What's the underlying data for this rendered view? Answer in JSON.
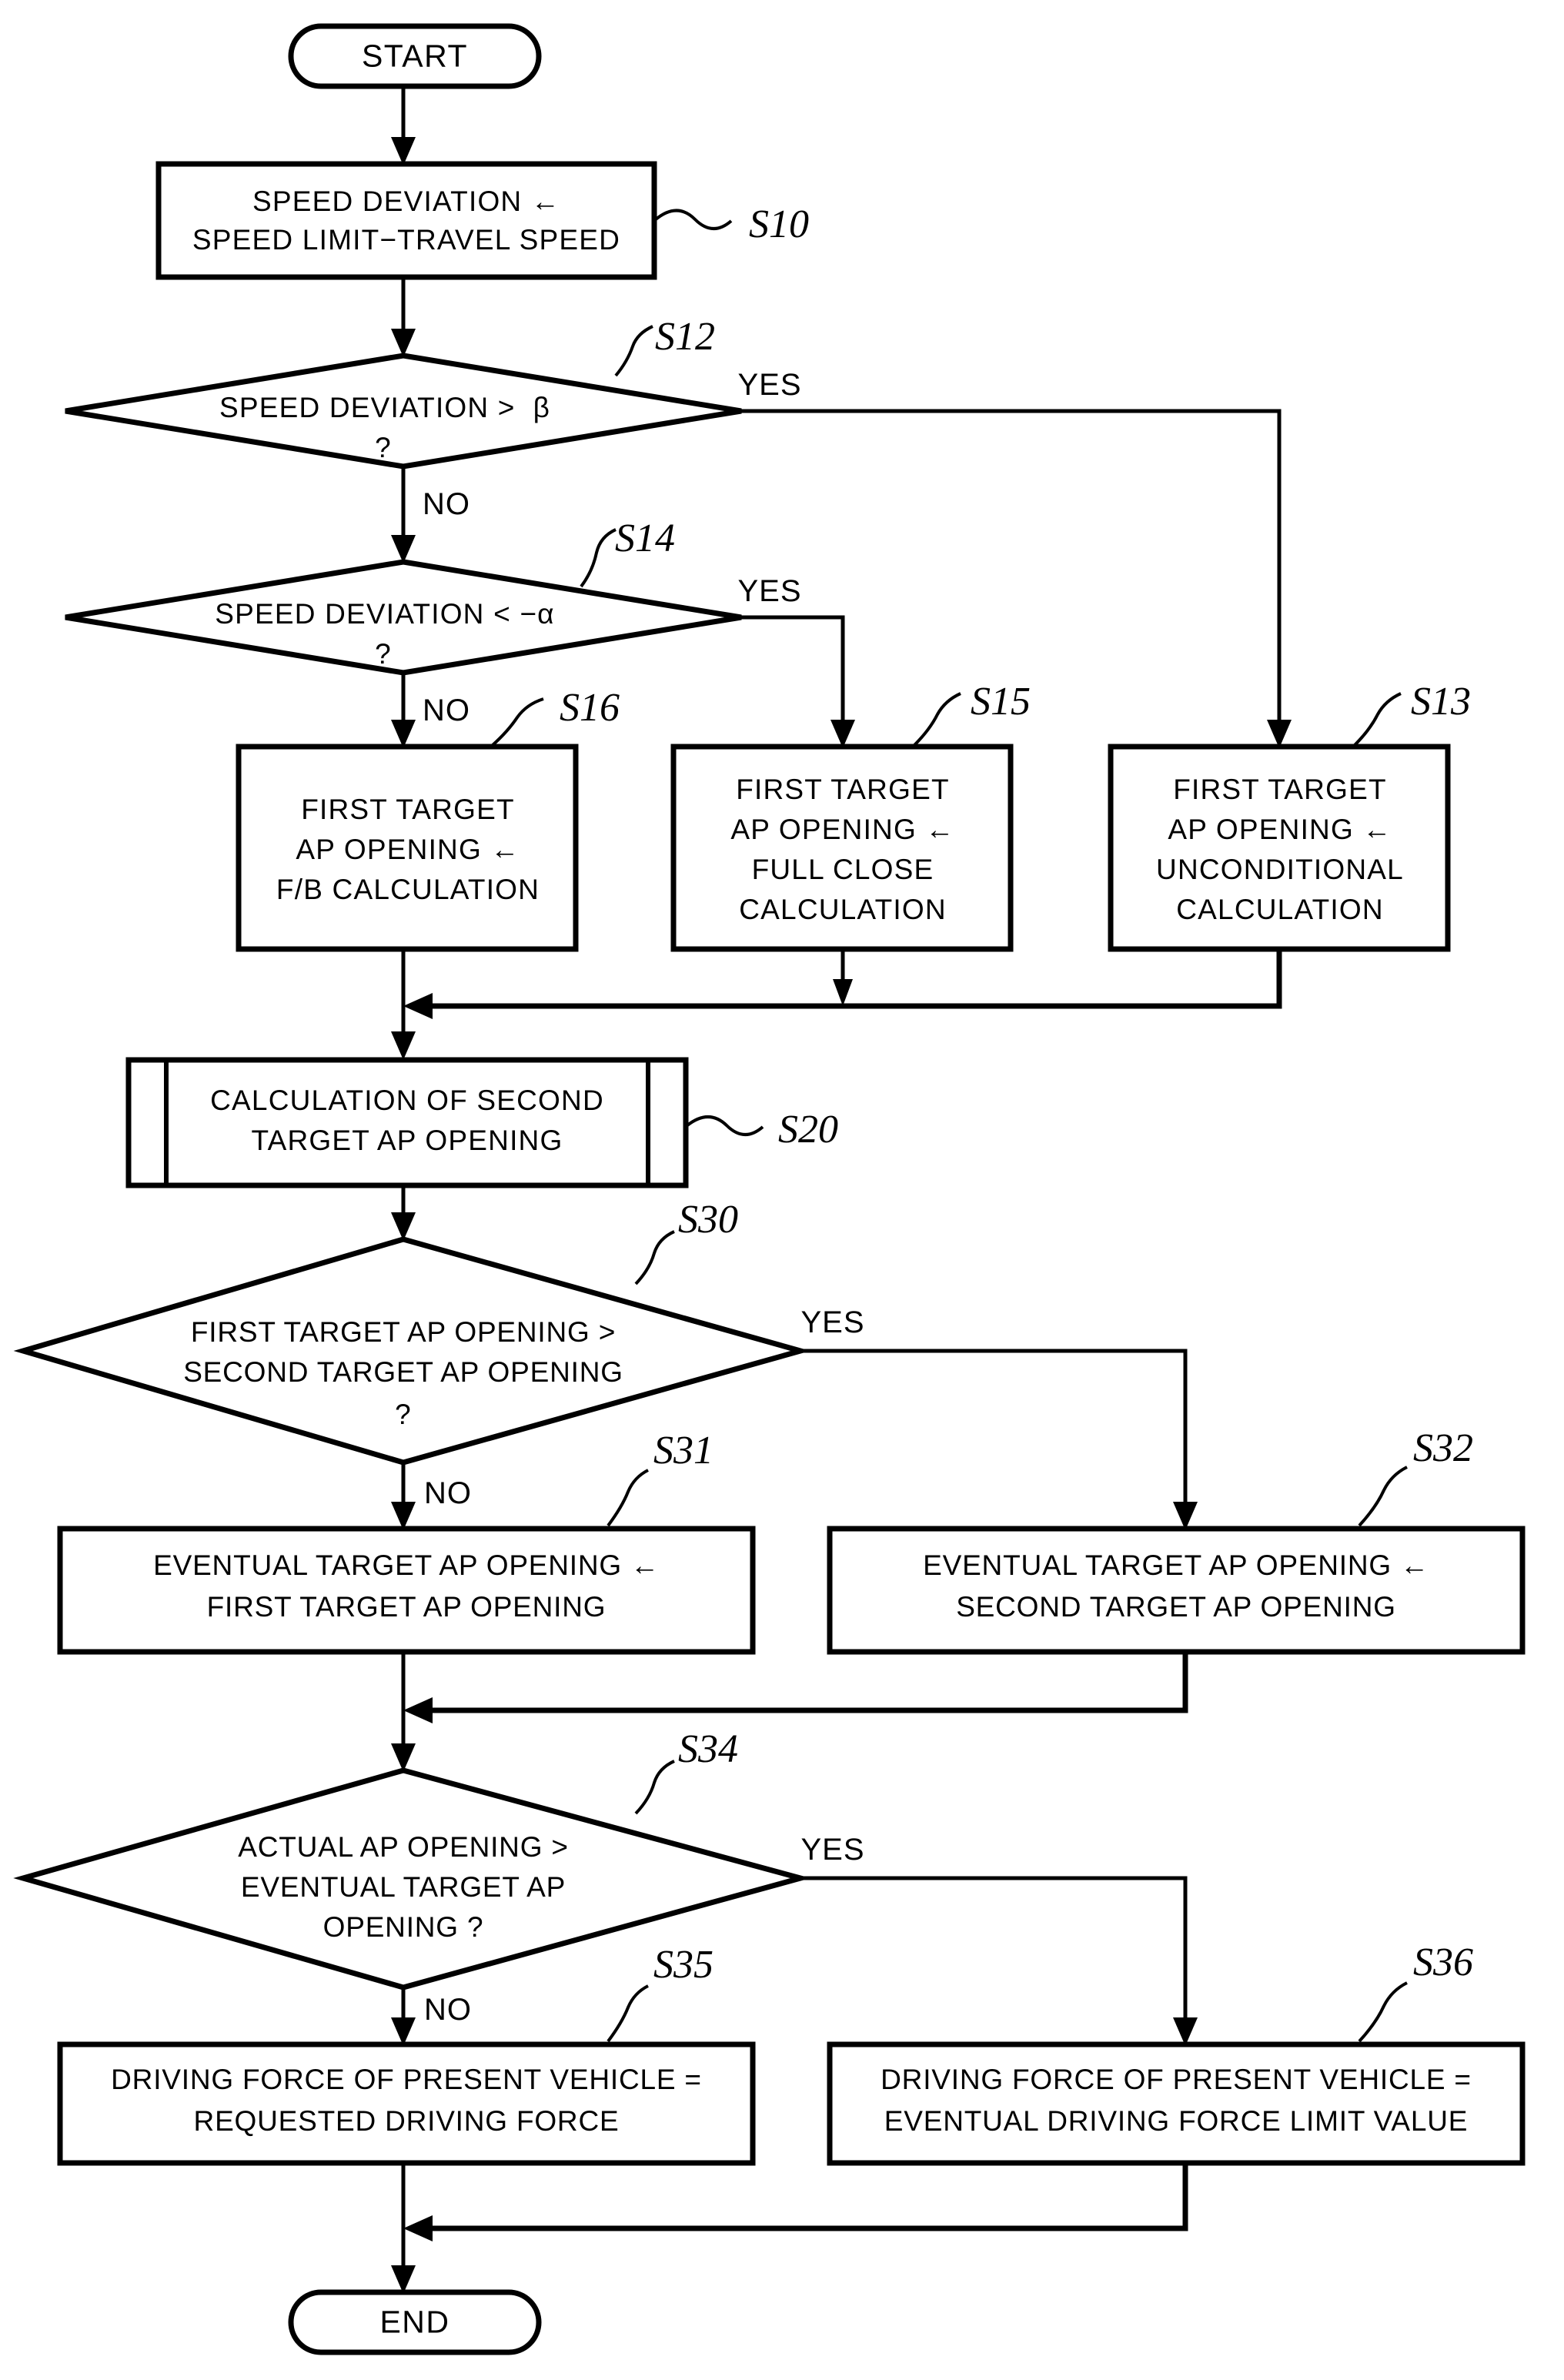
{
  "diagram": {
    "type": "flowchart",
    "title": "Vehicle driving force control flowchart",
    "orientation": "top-to-bottom"
  },
  "terminators": {
    "start": "START",
    "end": "END"
  },
  "branch_labels": {
    "yes": "YES",
    "no": "NO"
  },
  "nodes": [
    {
      "id": "S10",
      "step": "S10",
      "shape": "process",
      "lines": [
        "SPEED DEVIATION ←",
        "SPEED LIMIT−TRAVEL SPEED"
      ]
    },
    {
      "id": "S12",
      "step": "S12",
      "shape": "decision",
      "lines": [
        "SPEED DEVIATION >  β",
        "?"
      ]
    },
    {
      "id": "S14",
      "step": "S14",
      "shape": "decision",
      "lines": [
        "SPEED DEVIATION < −α",
        "?"
      ]
    },
    {
      "id": "S16",
      "step": "S16",
      "shape": "process",
      "lines": [
        "FIRST TARGET",
        "AP OPENING ←",
        "F/B CALCULATION"
      ]
    },
    {
      "id": "S15",
      "step": "S15",
      "shape": "process",
      "lines": [
        "FIRST TARGET",
        "AP OPENING ←",
        "FULL CLOSE",
        "CALCULATION"
      ]
    },
    {
      "id": "S13",
      "step": "S13",
      "shape": "process",
      "lines": [
        "FIRST TARGET",
        "AP OPENING ←",
        "UNCONDITIONAL",
        "CALCULATION"
      ]
    },
    {
      "id": "S20",
      "step": "S20",
      "shape": "predefined-process",
      "lines": [
        "CALCULATION OF SECOND",
        "TARGET AP OPENING"
      ]
    },
    {
      "id": "S30",
      "step": "S30",
      "shape": "decision",
      "lines": [
        "FIRST TARGET AP OPENING >",
        "SECOND TARGET AP OPENING",
        "?"
      ]
    },
    {
      "id": "S31",
      "step": "S31",
      "shape": "process",
      "lines": [
        "EVENTUAL TARGET AP OPENING ←",
        "FIRST TARGET AP OPENING"
      ]
    },
    {
      "id": "S32",
      "step": "S32",
      "shape": "process",
      "lines": [
        "EVENTUAL TARGET AP OPENING ←",
        "SECOND TARGET AP OPENING"
      ]
    },
    {
      "id": "S34",
      "step": "S34",
      "shape": "decision",
      "lines": [
        "ACTUAL AP OPENING >",
        "EVENTUAL TARGET AP",
        "OPENING ?"
      ]
    },
    {
      "id": "S35",
      "step": "S35",
      "shape": "process",
      "lines": [
        "DRIVING FORCE OF PRESENT VEHICLE =",
        "REQUESTED DRIVING FORCE"
      ]
    },
    {
      "id": "S36",
      "step": "S36",
      "shape": "process",
      "lines": [
        "DRIVING FORCE OF PRESENT VEHICLE =",
        "EVENTUAL DRIVING FORCE LIMIT VALUE"
      ]
    }
  ],
  "text": {
    "start": "START",
    "end": "END",
    "s10_l1": "SPEED DEVIATION ←",
    "s10_l2": "SPEED LIMIT−TRAVEL SPEED",
    "s10_step": "S10",
    "s12_l1": "SPEED DEVIATION >  β",
    "s12_l2": "?",
    "s12_step": "S12",
    "s12_yes": "YES",
    "s12_no": "NO",
    "s14_l1": "SPEED DEVIATION < −α",
    "s14_l2": "?",
    "s14_step": "S14",
    "s14_yes": "YES",
    "s14_no": "NO",
    "s16_l1": "FIRST TARGET",
    "s16_l2": "AP OPENING ←",
    "s16_l3": "F/B CALCULATION",
    "s16_step": "S16",
    "s15_l1": "FIRST TARGET",
    "s15_l2": "AP OPENING ←",
    "s15_l3": "FULL CLOSE",
    "s15_l4": "CALCULATION",
    "s15_step": "S15",
    "s13_l1": "FIRST TARGET",
    "s13_l2": "AP OPENING ←",
    "s13_l3": "UNCONDITIONAL",
    "s13_l4": "CALCULATION",
    "s13_step": "S13",
    "s20_l1": "CALCULATION OF SECOND",
    "s20_l2": "TARGET AP OPENING",
    "s20_step": "S20",
    "s30_l1": "FIRST TARGET AP OPENING >",
    "s30_l2": "SECOND TARGET AP OPENING",
    "s30_l3": "?",
    "s30_step": "S30",
    "s30_yes": "YES",
    "s30_no": "NO",
    "s31_l1": "EVENTUAL TARGET AP OPENING ←",
    "s31_l2": "FIRST TARGET AP OPENING",
    "s31_step": "S31",
    "s32_l1": "EVENTUAL TARGET AP OPENING ←",
    "s32_l2": "SECOND TARGET AP OPENING",
    "s32_step": "S32",
    "s34_l1": "ACTUAL AP OPENING >",
    "s34_l2": "EVENTUAL TARGET AP",
    "s34_l3": "OPENING ?",
    "s34_step": "S34",
    "s34_yes": "YES",
    "s34_no": "NO",
    "s35_l1": "DRIVING FORCE OF PRESENT VEHICLE =",
    "s35_l2": "REQUESTED DRIVING FORCE",
    "s35_step": "S35",
    "s36_l1": "DRIVING FORCE OF PRESENT VEHICLE =",
    "s36_l2": "EVENTUAL DRIVING FORCE LIMIT VALUE",
    "s36_step": "S36"
  },
  "colors": {
    "line": "#000000",
    "fill": "#ffffff",
    "text": "#000000"
  }
}
